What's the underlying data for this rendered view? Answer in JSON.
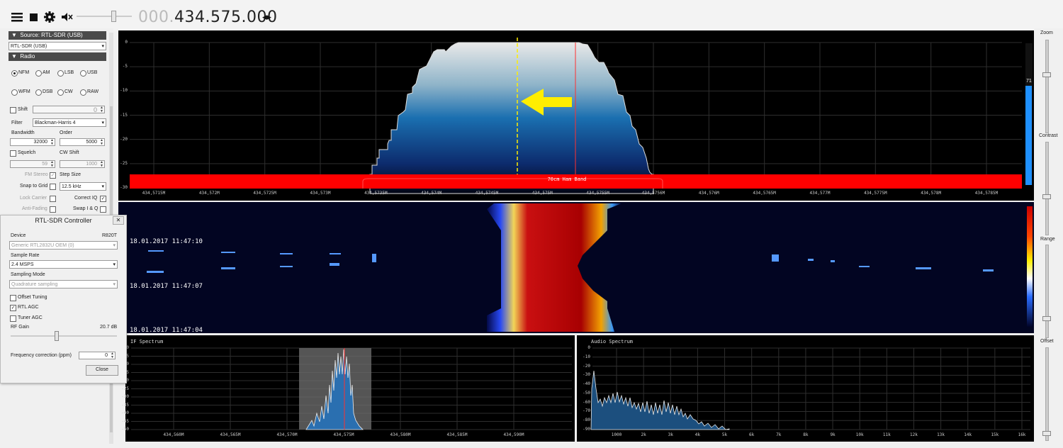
{
  "toolbar": {
    "frequency_dim": "000.",
    "frequency": "434.575.000",
    "icons": [
      "menu-icon",
      "stop-icon",
      "gear-icon",
      "mute-icon"
    ]
  },
  "source": {
    "header": "Source: RTL-SDR (USB)",
    "selected": "RTL-SDR (USB)"
  },
  "radio": {
    "header": "Radio",
    "modes": [
      "NFM",
      "AM",
      "LSB",
      "USB",
      "WFM",
      "DSB",
      "CW",
      "RAW"
    ],
    "selected_mode": "NFM",
    "shift_label": "Shift",
    "shift_value": "0",
    "filter_label": "Filter",
    "filter_value": "Blackman-Harris 4",
    "bandwidth_label": "Bandwidth",
    "bandwidth_value": "32000",
    "order_label": "Order",
    "order_value": "5000",
    "squelch_label": "Squelch",
    "squelch_value": "59",
    "cw_shift_label": "CW Shift",
    "cw_shift_value": "1000",
    "fm_stereo_label": "FM Stereo",
    "step_size_label": "Step Size",
    "snap_label": "Snap to Grid",
    "step_value": "12.5 kHz",
    "lock_carrier_label": "Lock Carrier",
    "correct_iq_label": "Correct IQ",
    "anti_fading_label": "Anti-Fading",
    "swap_iq_label": "Swap I & Q"
  },
  "dialog": {
    "title": "RTL-SDR Controller",
    "device_label": "Device",
    "device_tuner": "R820T",
    "device_value": "Generic RTL2832U OEM (0)",
    "sample_rate_label": "Sample Rate",
    "sample_rate_value": "2.4 MSPS",
    "sampling_mode_label": "Sampling Mode",
    "sampling_mode_value": "Quadrature sampling",
    "offset_tuning_label": "Offset Tuning",
    "rtl_agc_label": "RTL AGC",
    "tuner_agc_label": "Tuner AGC",
    "rf_gain_label": "RF Gain",
    "rf_gain_value": "20.7 dB",
    "freq_corr_label": "Frequency correction (ppm)",
    "freq_corr_value": "0",
    "close_label": "Close",
    "close_x": "✕"
  },
  "spectrum": {
    "y_labels": [
      "0",
      "-5",
      "-10",
      "-15",
      "-20",
      "-25",
      "-30"
    ],
    "x_labels": [
      "434,5715M",
      "434,572M",
      "434,5725M",
      "434,573M",
      "434,5735M",
      "434,574M",
      "434,5745M",
      "434,575M",
      "434,5755M",
      "434,5756M",
      "434,576M",
      "434,5765M",
      "434,577M",
      "434,5775M",
      "434,578M",
      "434,5785M"
    ],
    "band_label": "70cm Ham Band",
    "level_value": "71"
  },
  "waterfall": {
    "timestamps": [
      "18.01.2017 11:47:10",
      "18.01.2017 11:47:07",
      "18.01.2017 11:47:04"
    ]
  },
  "if_spectrum": {
    "title": "IF Spectrum",
    "y_labels": [
      "0",
      "-5",
      "-10",
      "-15",
      "-20",
      "-25",
      "-30",
      "-35",
      "-40",
      "-45",
      "-50"
    ],
    "x_labels": [
      "434,560M",
      "434,565M",
      "434,570M",
      "434,575M",
      "434,580M",
      "434,585M",
      "434,590M"
    ]
  },
  "audio_spectrum": {
    "title": "Audio Spectrum",
    "y_labels": [
      "0",
      "-10",
      "-20",
      "-30",
      "-40",
      "-50",
      "-60",
      "-70",
      "-80",
      "-90"
    ],
    "x_labels": [
      "1000",
      "2k",
      "3k",
      "4k",
      "5k",
      "6k",
      "7k",
      "8k",
      "9k",
      "10k",
      "11k",
      "12k",
      "13k",
      "14k",
      "15k",
      "16k"
    ]
  },
  "right_panel": {
    "zoom": "Zoom",
    "contrast": "Contrast",
    "range": "Range",
    "offset": "Offset"
  },
  "colors": {
    "band_red": "#ff0000",
    "arrow_yellow": "#ffee00",
    "level_blue": "#1e90ff"
  }
}
